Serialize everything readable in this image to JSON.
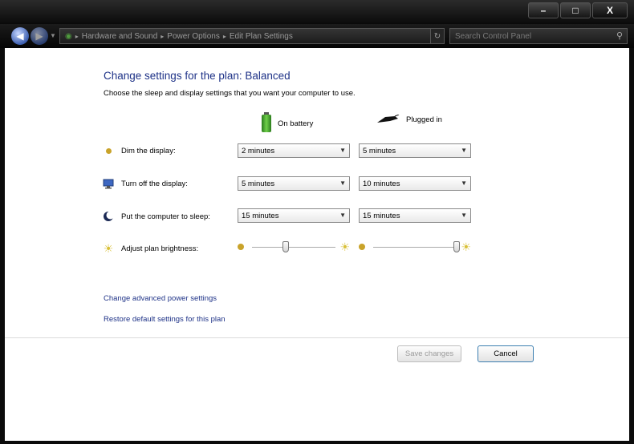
{
  "window": {
    "controls": {
      "minimize": "–",
      "maximize": "□",
      "close": "X"
    }
  },
  "nav": {
    "back_icon": "back-arrow-icon",
    "forward_icon": "forward-arrow-icon",
    "breadcrumbs": [
      "Hardware and Sound",
      "Power Options",
      "Edit Plan Settings"
    ],
    "search_placeholder": "Search Control Panel"
  },
  "page": {
    "title": "Change settings for the plan: Balanced",
    "subtitle": "Choose the sleep and display settings that you want your computer to use."
  },
  "columns": {
    "on_battery": "On battery",
    "plugged_in": "Plugged in"
  },
  "settings": [
    {
      "label": "Dim the display:",
      "icon": "dim-display-icon",
      "on_battery": "2 minutes",
      "plugged_in": "5 minutes"
    },
    {
      "label": "Turn off the display:",
      "icon": "monitor-icon",
      "on_battery": "5 minutes",
      "plugged_in": "10 minutes"
    },
    {
      "label": "Put the computer to sleep:",
      "icon": "moon-icon",
      "on_battery": "15 minutes",
      "plugged_in": "15 minutes"
    }
  ],
  "brightness": {
    "label": "Adjust plan brightness:",
    "icon": "sun-icon",
    "on_battery_level": 0.4,
    "plugged_in_level": 1.0
  },
  "links": {
    "advanced": "Change advanced power settings",
    "restore": "Restore default settings for this plan"
  },
  "buttons": {
    "save": "Save changes",
    "cancel": "Cancel"
  },
  "colors": {
    "title": "#1e3287",
    "link": "#1e3287"
  }
}
